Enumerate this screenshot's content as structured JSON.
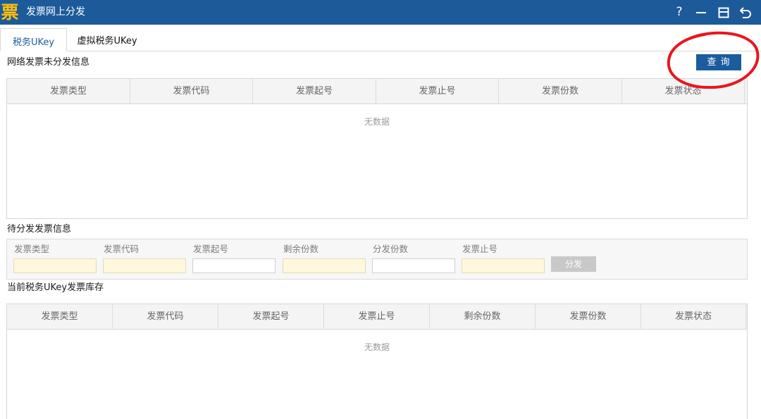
{
  "window": {
    "logo_text": "票",
    "title": "发票网上分发",
    "help_label": "?"
  },
  "tabs": [
    {
      "label": "税务UKey",
      "active": true
    },
    {
      "label": "虚拟税务UKey",
      "active": false
    }
  ],
  "undistributed": {
    "title": "网络发票未分发信息",
    "query_button": "查 询",
    "columns": [
      "发票类型",
      "发票代码",
      "发票起号",
      "发票止号",
      "发票份数",
      "发票状态"
    ],
    "rows": [],
    "empty_text": "无数据"
  },
  "pending": {
    "title": "待分发发票信息",
    "fields": [
      {
        "label": "发票类型",
        "value": ""
      },
      {
        "label": "发票代码",
        "value": ""
      },
      {
        "label": "发票起号",
        "value": ""
      },
      {
        "label": "剩余份数",
        "value": ""
      },
      {
        "label": "分发份数",
        "value": ""
      },
      {
        "label": "发票止号",
        "value": ""
      }
    ],
    "distribute_button": "分发",
    "distribute_enabled": false
  },
  "inventory": {
    "title": "当前税务UKey发票库存",
    "columns": [
      "发票类型",
      "发票代码",
      "发票起号",
      "发票止号",
      "剩余份数",
      "发票份数",
      "发票状态"
    ],
    "rows": [],
    "empty_text": "无数据"
  },
  "icons": {
    "logo": "invoice-logo-icon",
    "help": "help-icon",
    "minimize": "minimize-icon",
    "restore": "restore-icon",
    "back": "back-icon",
    "annotation": "red-circle-annotation"
  },
  "colors": {
    "title_bar": "#1c5a9a",
    "accent": "#1b5c9d",
    "logo": "#f7c21b",
    "readonly_input": "#fff8dc",
    "disabled_button": "#c8c8c8",
    "annotation": "#e8161f"
  }
}
